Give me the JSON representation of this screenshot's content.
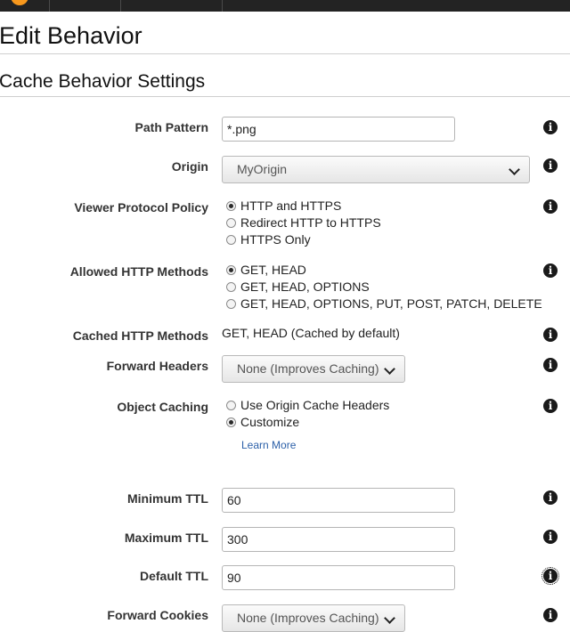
{
  "page": {
    "title": "Edit Behavior"
  },
  "section": {
    "title": "Cache Behavior Settings"
  },
  "fields": {
    "path_pattern": {
      "label": "Path Pattern",
      "value": "*.png"
    },
    "origin": {
      "label": "Origin",
      "value": "MyOrigin"
    },
    "viewer_protocol_policy": {
      "label": "Viewer Protocol Policy",
      "options": [
        "HTTP and HTTPS",
        "Redirect HTTP to HTTPS",
        "HTTPS Only"
      ],
      "selected": "HTTP and HTTPS"
    },
    "allowed_http_methods": {
      "label": "Allowed HTTP Methods",
      "options": [
        "GET, HEAD",
        "GET, HEAD, OPTIONS",
        "GET, HEAD, OPTIONS, PUT, POST, PATCH, DELETE"
      ],
      "selected": "GET, HEAD"
    },
    "cached_http_methods": {
      "label": "Cached HTTP Methods",
      "value": "GET, HEAD (Cached by default)"
    },
    "forward_headers": {
      "label": "Forward Headers",
      "value": "None (Improves Caching)"
    },
    "object_caching": {
      "label": "Object Caching",
      "options": [
        "Use Origin Cache Headers",
        "Customize"
      ],
      "selected": "Customize",
      "learn_more": "Learn More"
    },
    "minimum_ttl": {
      "label": "Minimum TTL",
      "value": "60"
    },
    "maximum_ttl": {
      "label": "Maximum TTL",
      "value": "300"
    },
    "default_ttl": {
      "label": "Default TTL",
      "value": "90"
    },
    "forward_cookies": {
      "label": "Forward Cookies",
      "value": "None (Improves Caching)"
    }
  },
  "icons": {
    "info": "info-icon",
    "dropdown": "chevron-down-icon"
  },
  "colors": {
    "topbar": "#232323",
    "brand": "#f7981d",
    "link": "#2b5fa8"
  }
}
